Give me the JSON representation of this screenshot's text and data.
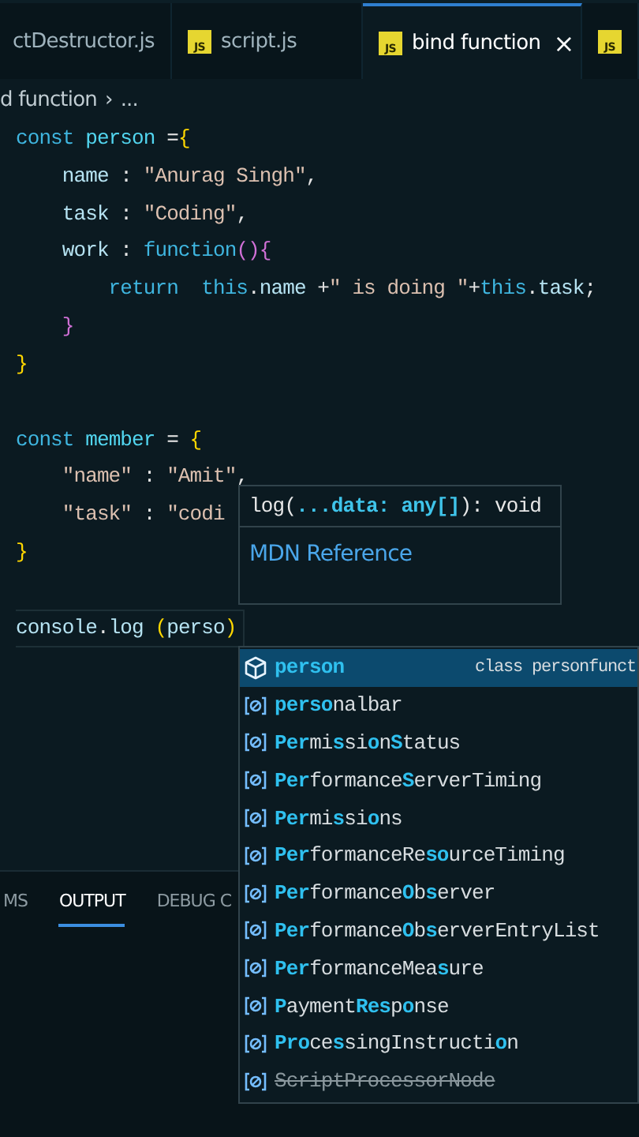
{
  "tabs": [
    {
      "label": "ctDestructor.js",
      "selected": false
    },
    {
      "icon_text": "JS",
      "label": "script.js",
      "selected": false
    },
    {
      "icon_text": "JS",
      "label": "bind function",
      "selected": true,
      "close": "×"
    },
    {
      "icon_text": "JS",
      "selected": false
    }
  ],
  "breadcrumb": {
    "path": "d function",
    "separator": "›",
    "more": "..."
  },
  "code_blocks": [
    [
      {
        "tokens": [
          {
            "t": "const",
            "kind": "kw"
          },
          {
            "t": " person",
            "kind": "var"
          },
          {
            "t": " =",
            "kind": "p"
          },
          {
            "t": "{",
            "kind": "b1"
          }
        ]
      },
      {
        "tokens": [
          {
            "t": "    name",
            "kind": "prop"
          },
          {
            "t": " : ",
            "kind": "p"
          },
          {
            "t": "\"Anurag Singh\"",
            "kind": "str"
          },
          {
            "t": ",",
            "kind": "p"
          }
        ]
      },
      {
        "tokens": [
          {
            "t": "    task",
            "kind": "prop"
          },
          {
            "t": " : ",
            "kind": "p"
          },
          {
            "t": "\"Coding\"",
            "kind": "str"
          },
          {
            "t": ",",
            "kind": "p"
          }
        ]
      },
      {
        "tokens": [
          {
            "t": "    work",
            "kind": "prop"
          },
          {
            "t": " : ",
            "kind": "p"
          },
          {
            "t": "function",
            "kind": "kw"
          },
          {
            "t": "()",
            "kind": "b2"
          },
          {
            "t": "{",
            "kind": "b2"
          }
        ]
      },
      {
        "tokens": [
          {
            "t": "        return",
            "kind": "kw"
          },
          {
            "t": "  this",
            "kind": "kw"
          },
          {
            "t": ".",
            "kind": "p"
          },
          {
            "t": "name",
            "kind": "prop"
          },
          {
            "t": " +",
            "kind": "p"
          },
          {
            "t": "\" is doing \"",
            "kind": "str"
          },
          {
            "t": "+",
            "kind": "p"
          },
          {
            "t": "this",
            "kind": "kw"
          },
          {
            "t": ".",
            "kind": "p"
          },
          {
            "t": "task",
            "kind": "prop"
          },
          {
            "t": ";",
            "kind": "p"
          }
        ]
      },
      {
        "tokens": [
          {
            "t": "    }",
            "kind": "b2"
          }
        ]
      },
      {
        "tokens": [
          {
            "t": "}",
            "kind": "b1"
          }
        ]
      }
    ],
    [
      {
        "tokens": [
          {
            "t": "const",
            "kind": "kw"
          },
          {
            "t": " member",
            "kind": "var"
          },
          {
            "t": " = ",
            "kind": "p"
          },
          {
            "t": "{",
            "kind": "b1"
          }
        ]
      },
      {
        "tokens": [
          {
            "t": "    \"name\"",
            "kind": "str"
          },
          {
            "t": " : ",
            "kind": "p"
          },
          {
            "t": "\"Amit\"",
            "kind": "str"
          },
          {
            "t": ",",
            "kind": "p"
          }
        ]
      },
      {
        "tokens": [
          {
            "t": "    \"task\"",
            "kind": "str"
          },
          {
            "t": " : ",
            "kind": "p"
          },
          {
            "t": "\"codi",
            "kind": "str"
          }
        ]
      },
      {
        "tokens": [
          {
            "t": "}",
            "kind": "b1"
          }
        ]
      }
    ],
    [
      {
        "tokens": [
          {
            "t": "console",
            "kind": "prop"
          },
          {
            "t": ".",
            "kind": "p"
          },
          {
            "t": "log",
            "kind": "prop"
          },
          {
            "t": " (",
            "kind": "b1"
          },
          {
            "t": "perso",
            "kind": "prop"
          },
          {
            "t": ")",
            "kind": "b1"
          }
        ],
        "current": true
      }
    ]
  ],
  "hover": {
    "signature": "log(**...data: any[]**): void",
    "link": "MDN Reference"
  },
  "suggestions": [
    {
      "kind": "class",
      "label": "**person**",
      "detail": "class personfunct",
      "selected": true,
      "deprecated": false
    },
    {
      "kind": "variable",
      "label": "**perso**nalbar",
      "selected": false,
      "deprecated": false
    },
    {
      "kind": "variable",
      "label": "**Per**mi**s**si**o**n**S**tatus",
      "selected": false,
      "deprecated": false
    },
    {
      "kind": "variable",
      "label": "**Per**formance**S**erverTiming",
      "selected": false,
      "deprecated": false
    },
    {
      "kind": "variable",
      "label": "**Per**mi**s**si**o**ns",
      "selected": false,
      "deprecated": false
    },
    {
      "kind": "variable",
      "label": "**Per**formanceRe**so**urceTiming",
      "selected": false,
      "deprecated": false
    },
    {
      "kind": "variable",
      "label": "**Per**formance**O**b**s**erver",
      "selected": false,
      "deprecated": false
    },
    {
      "kind": "variable",
      "label": "**Per**formance**O**b**s**erverEntryList",
      "selected": false,
      "deprecated": false
    },
    {
      "kind": "variable",
      "label": "**Per**formanceMea**s**ure",
      "selected": false,
      "deprecated": false
    },
    {
      "kind": "variable",
      "label": "**P**ayment**Res**p**o**nse",
      "selected": false,
      "deprecated": false
    },
    {
      "kind": "variable",
      "label": "**Pro**ce**s**singInstructi**o**n",
      "selected": false,
      "deprecated": false
    },
    {
      "kind": "variable",
      "label": "ScriptProcessorNode",
      "selected": false,
      "deprecated": true
    }
  ],
  "panel_tabs": [
    {
      "label": "MS",
      "selected": false
    },
    {
      "label": "OUTPUT",
      "selected": true
    },
    {
      "label": "DEBUG C",
      "selected": false
    }
  ]
}
